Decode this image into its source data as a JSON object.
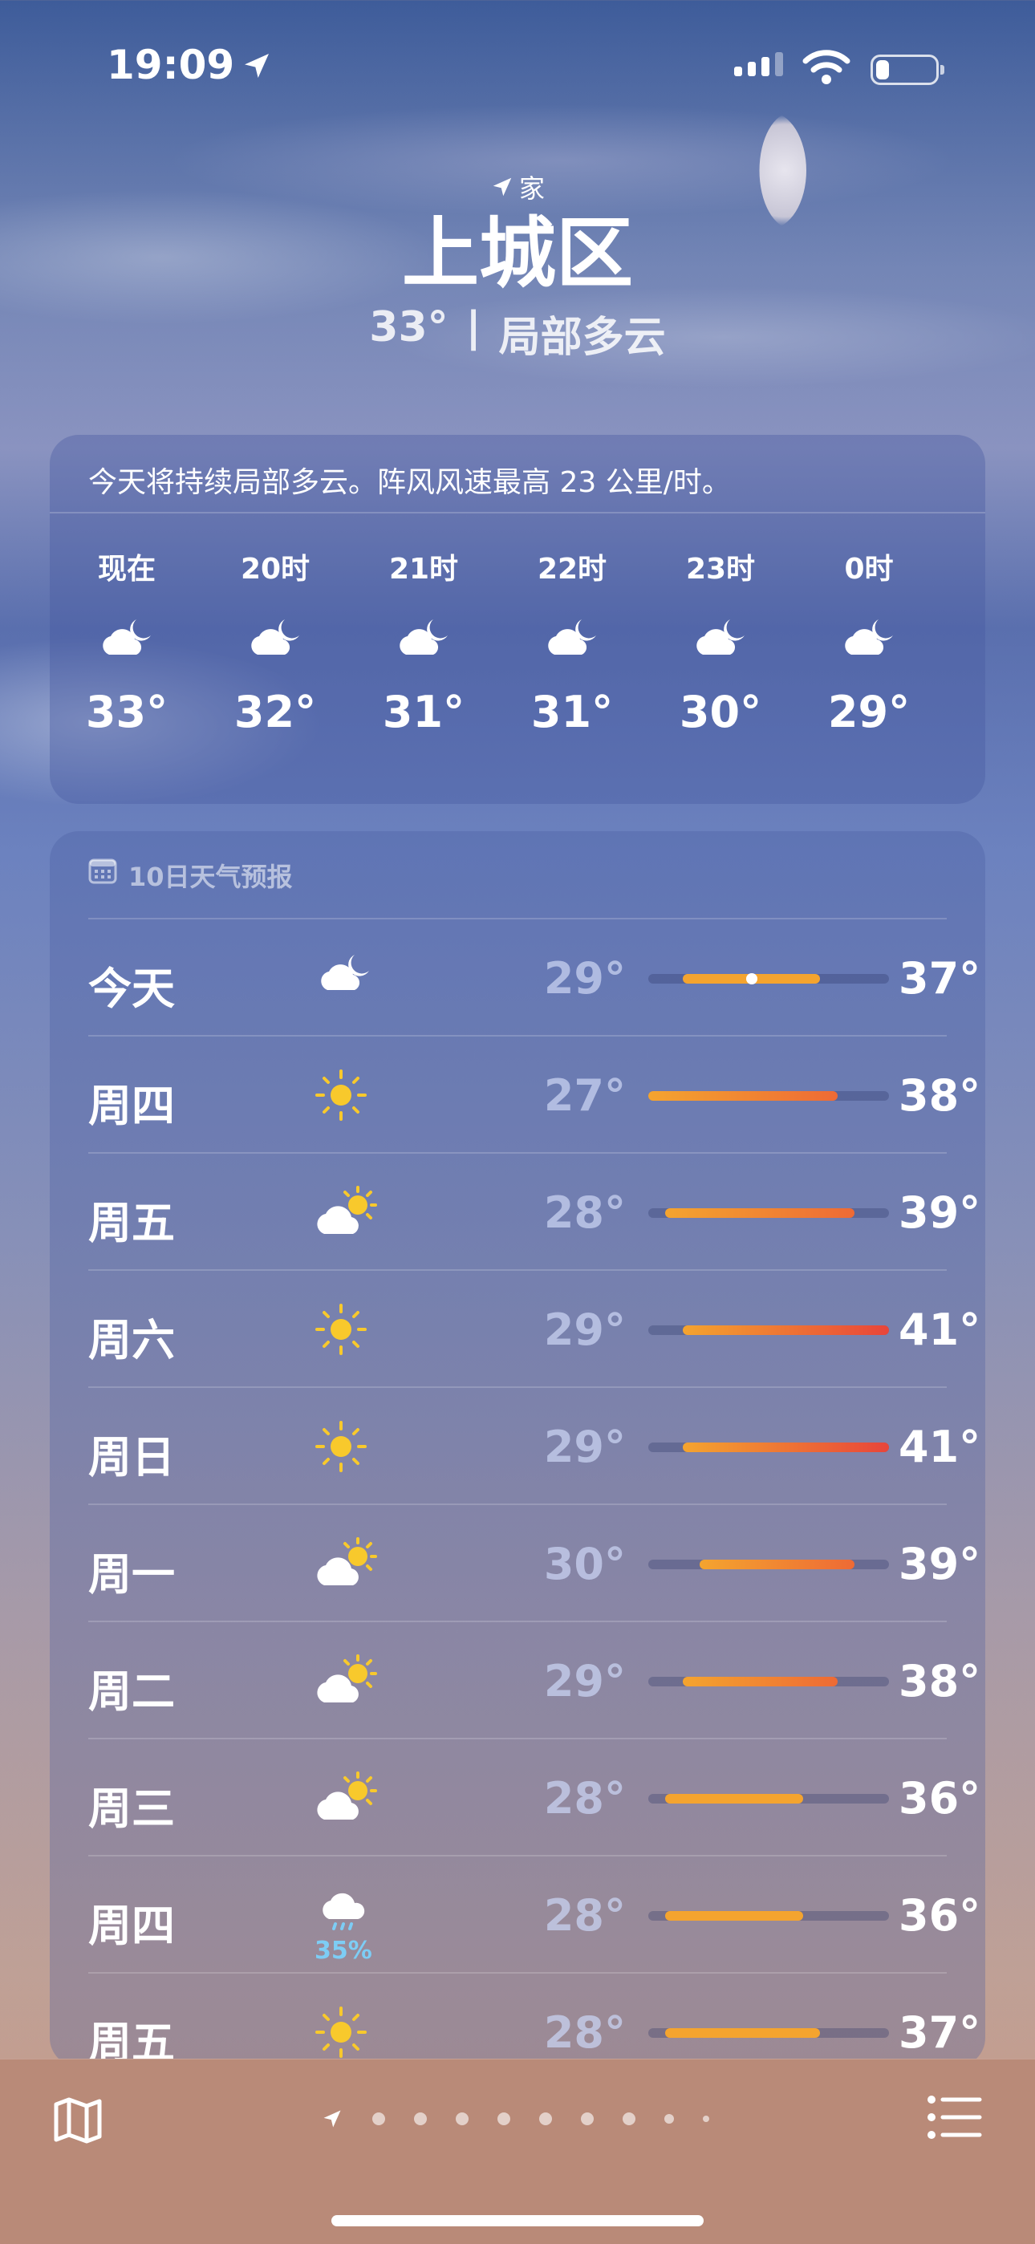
{
  "status": {
    "time": "19:09"
  },
  "header": {
    "home_label": "家",
    "city": "上城区",
    "current_temp": "33°",
    "separator": "|",
    "condition": "局部多云"
  },
  "hourly": {
    "description": "今天将持续局部多云。阵风风速最高 23 公里/时。",
    "hours": [
      {
        "label": "现在",
        "icon": "partly-cloudy-night-icon",
        "temp": "33°"
      },
      {
        "label": "20时",
        "icon": "partly-cloudy-night-icon",
        "temp": "32°"
      },
      {
        "label": "21时",
        "icon": "partly-cloudy-night-icon",
        "temp": "31°"
      },
      {
        "label": "22时",
        "icon": "partly-cloudy-night-icon",
        "temp": "31°"
      },
      {
        "label": "23时",
        "icon": "partly-cloudy-night-icon",
        "temp": "30°"
      },
      {
        "label": "0时",
        "icon": "partly-cloudy-night-icon",
        "temp": "29°"
      }
    ]
  },
  "daily": {
    "title": "10日天气预报",
    "range_min": 27,
    "range_max": 41,
    "days": [
      {
        "day": "今天",
        "icon": "partly-cloudy-night-icon",
        "lo": "29°",
        "hi": "37°",
        "lo_v": 29,
        "hi_v": 37,
        "current_v": 33
      },
      {
        "day": "周四",
        "icon": "sun-icon",
        "lo": "27°",
        "hi": "38°",
        "lo_v": 27,
        "hi_v": 38
      },
      {
        "day": "周五",
        "icon": "partly-cloudy-day-icon",
        "lo": "28°",
        "hi": "39°",
        "lo_v": 28,
        "hi_v": 39
      },
      {
        "day": "周六",
        "icon": "sun-icon",
        "lo": "29°",
        "hi": "41°",
        "lo_v": 29,
        "hi_v": 41
      },
      {
        "day": "周日",
        "icon": "sun-icon",
        "lo": "29°",
        "hi": "41°",
        "lo_v": 29,
        "hi_v": 41
      },
      {
        "day": "周一",
        "icon": "partly-cloudy-day-icon",
        "lo": "30°",
        "hi": "39°",
        "lo_v": 30,
        "hi_v": 39
      },
      {
        "day": "周二",
        "icon": "partly-cloudy-day-icon",
        "lo": "29°",
        "hi": "38°",
        "lo_v": 29,
        "hi_v": 38
      },
      {
        "day": "周三",
        "icon": "partly-cloudy-day-icon",
        "lo": "28°",
        "hi": "36°",
        "lo_v": 28,
        "hi_v": 36
      },
      {
        "day": "周四",
        "icon": "rain-icon",
        "precip": "35%",
        "lo": "28°",
        "hi": "36°",
        "lo_v": 28,
        "hi_v": 36
      },
      {
        "day": "周五",
        "icon": "sun-icon",
        "lo": "28°",
        "hi": "37°",
        "lo_v": 28,
        "hi_v": 37
      }
    ]
  },
  "colors": {
    "bar_cool": "#f4a42f",
    "bar_hot": "#e8453a",
    "precip": "#7dcdf5"
  }
}
